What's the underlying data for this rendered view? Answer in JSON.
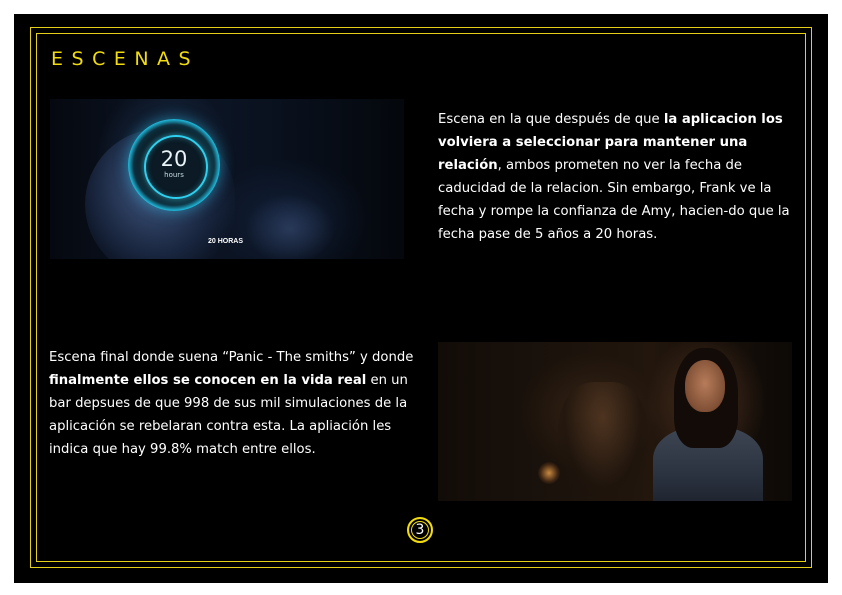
{
  "title": "ESCENAS",
  "scene1": {
    "image": {
      "timer_number": "20",
      "timer_unit": "hours",
      "caption": "20 HORAS"
    },
    "paragraph": {
      "part1": "Escena en la que después de que ",
      "bold": "la aplicacion los volviera a seleccionar para mantener una relación",
      "part2": ", ambos prometen no ver la fecha de caducidad de la relacion. Sin embargo, Frank ve la fecha y rompe la confianza de Amy, hacien-do que la fecha pase de 5 años a 20 horas."
    }
  },
  "scene2": {
    "paragraph": {
      "part1": "Escena final donde suena “Panic - The smiths” y donde ",
      "bold": "finalmente ellos se conocen en la vida real",
      "part2": " en un bar depsues de que 998 de sus mil simulaciones de la aplicación se rebelaran contra esta. La apliación les indica que hay 99.8% match entre ellos."
    }
  },
  "page_number": "3",
  "colors": {
    "accent": "#f2dc10",
    "background": "#000000",
    "text": "#ffffff"
  }
}
